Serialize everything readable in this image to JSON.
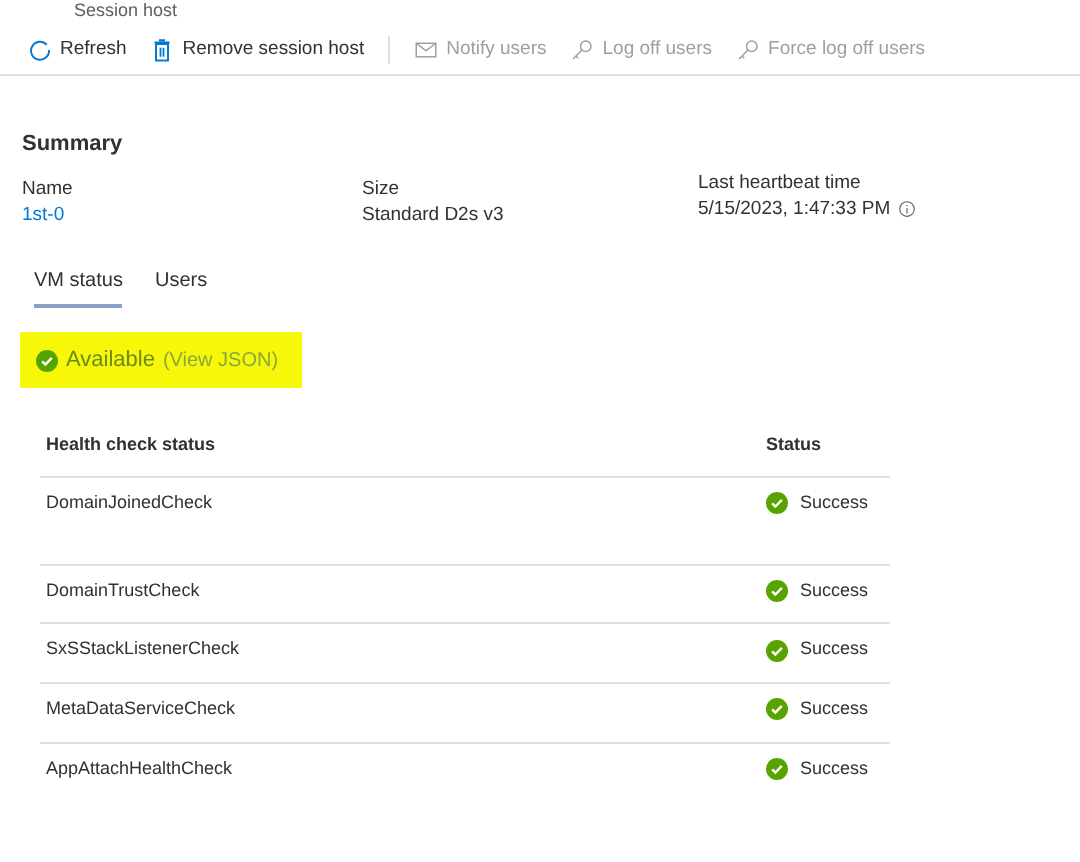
{
  "header": {
    "subtitle": "Session host"
  },
  "toolbar": [
    {
      "kind": "refresh",
      "label": "Refresh",
      "disabled": false
    },
    {
      "kind": "trash",
      "label": "Remove session host",
      "disabled": false
    },
    {
      "kind": "mail",
      "label": "Notify users",
      "disabled": true
    },
    {
      "kind": "key",
      "label": "Log off users",
      "disabled": true
    },
    {
      "kind": "key",
      "label": "Force log off users",
      "disabled": true
    }
  ],
  "summary": {
    "title": "Summary",
    "fields": [
      {
        "label": "Name",
        "value": "1st-0",
        "kind": "link"
      },
      {
        "label": "Size",
        "value": "Standard D2s v3",
        "kind": "text"
      },
      {
        "label": "Last heartbeat time",
        "value": "5/15/2023, 1:47:33 PM",
        "kind": "info"
      }
    ]
  },
  "tabs": [
    {
      "label": "VM status",
      "selected": true
    },
    {
      "label": "Users",
      "selected": false
    }
  ],
  "availability": {
    "status": "Available",
    "link": "(View JSON)",
    "highlighted": true
  },
  "table": {
    "columns": [
      "Health check status",
      "Status"
    ],
    "rows": [
      {
        "check": "DomainJoinedCheck",
        "status": "Success"
      },
      {
        "check": "DomainTrustCheck",
        "status": "Success"
      },
      {
        "check": "SxSStackListenerCheck",
        "status": "Success"
      },
      {
        "check": "MetaDataServiceCheck",
        "status": "Success"
      },
      {
        "check": "AppAttachHealthCheck",
        "status": "Success"
      }
    ]
  }
}
